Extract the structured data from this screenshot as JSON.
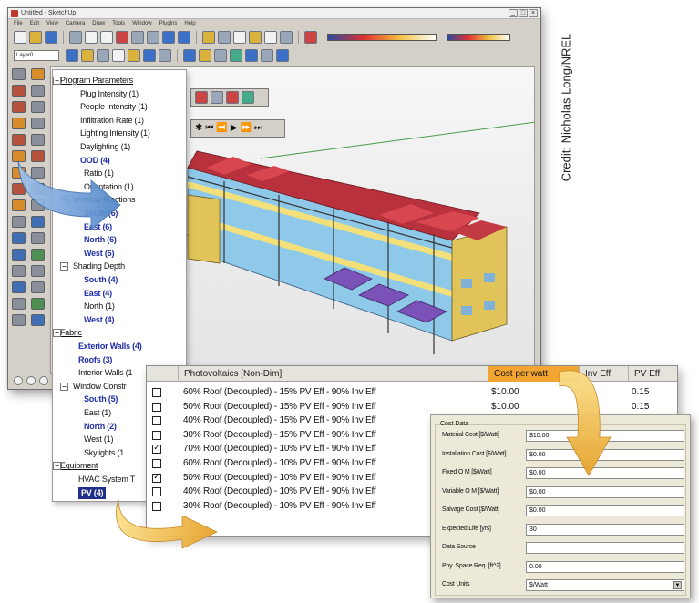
{
  "credit": "Credit: Nicholas Long/NREL",
  "tree": {
    "items": [
      {
        "text": "Program Parameters",
        "style": "u"
      },
      {
        "text": "Plug Intensity (1)",
        "style": ""
      },
      {
        "text": "People Intensity (1)",
        "style": ""
      },
      {
        "text": "Infiltration Rate (1)",
        "style": ""
      },
      {
        "text": "Lighting Intensity (1)",
        "style": ""
      },
      {
        "text": "Daylighting (1)",
        "style": ""
      },
      {
        "text": "OOD (4)",
        "style": "b"
      },
      {
        "text": "Ratio (1)",
        "style": ""
      },
      {
        "text": "Orientation (1)",
        "style": ""
      },
      {
        "text": "Window Fractions",
        "style": ""
      },
      {
        "text": "South (6)",
        "style": "b"
      },
      {
        "text": "East (6)",
        "style": "b"
      },
      {
        "text": "North (6)",
        "style": "b"
      },
      {
        "text": "West (6)",
        "style": "b"
      },
      {
        "text": "Shading Depth",
        "style": ""
      },
      {
        "text": "South (4)",
        "style": "b"
      },
      {
        "text": "East (4)",
        "style": "b"
      },
      {
        "text": "North (1)",
        "style": ""
      },
      {
        "text": "West (4)",
        "style": "b"
      },
      {
        "text": "Fabric",
        "style": "u"
      },
      {
        "text": "Exterior Walls (4)",
        "style": "b"
      },
      {
        "text": "Roofs (3)",
        "style": "b"
      },
      {
        "text": "Interior Walls (1",
        "style": ""
      },
      {
        "text": "Window Constr",
        "style": ""
      },
      {
        "text": "South (5)",
        "style": "b"
      },
      {
        "text": "East (1)",
        "style": ""
      },
      {
        "text": "North (2)",
        "style": "b"
      },
      {
        "text": "West (1)",
        "style": ""
      },
      {
        "text": "Skylights (1",
        "style": ""
      },
      {
        "text": "Equipment",
        "style": "u"
      },
      {
        "text": "HVAC System T",
        "style": ""
      },
      {
        "text": "PV (4)",
        "style": "sel"
      }
    ]
  },
  "pv_table": {
    "columns": [
      "Photovoltaics [Non-Dim]",
      "Cost per watt",
      "Inv Eff",
      "PV Eff"
    ],
    "rows": [
      {
        "label": "60% Roof (Decoupled) - 15% PV Eff - 90% Inv Eff",
        "checked": false,
        "cost": "$10.00",
        "pv": "0.15"
      },
      {
        "label": "50% Roof (Decoupled) - 15% PV Eff - 90% Inv Eff",
        "checked": false,
        "cost": "$10.00",
        "pv": "0.15"
      },
      {
        "label": "40% Roof (Decoupled) - 15% PV Eff - 90% Inv Eff",
        "checked": false,
        "cost": "$10.00",
        "pv": ""
      },
      {
        "label": "30% Roof (Decoupled) - 15% PV Eff - 90% Inv Eff",
        "checked": false,
        "cost": "$10.00",
        "pv": ""
      },
      {
        "label": "70% Roof (Decoupled) - 10% PV Eff - 90% Inv Eff",
        "checked": true,
        "cost": "$10.00",
        "pv": ""
      },
      {
        "label": "60% Roof (Decoupled) - 10% PV Eff - 90% Inv Eff",
        "checked": false,
        "cost": "$10.00",
        "pv": ""
      },
      {
        "label": "50% Roof (Decoupled) - 10% PV Eff - 90% Inv Eff",
        "checked": true,
        "cost": "$10.00",
        "pv": ""
      },
      {
        "label": "40% Roof (Decoupled) - 10% PV Eff - 90% Inv Eff",
        "checked": false,
        "cost": "",
        "pv": ""
      },
      {
        "label": "30% Roof (Decoupled) - 10% PV Eff - 90% Inv Eff",
        "checked": false,
        "cost": "",
        "pv": ""
      }
    ]
  },
  "cost_data": {
    "title": "Cost Data",
    "fields": [
      {
        "label": "Material Cost [$/Watt]",
        "value": "$10.00"
      },
      {
        "label": "Installation Cost [$/Watt]",
        "value": "$0.00"
      },
      {
        "label": "Fixed O M [$/Watt]",
        "value": "$0.00"
      },
      {
        "label": "Variable O M [$/Watt]",
        "value": "$0.00"
      },
      {
        "label": "Salvage Cost [$/Watt]",
        "value": "$0.00"
      },
      {
        "label": "Expected Life [yrs]",
        "value": "30"
      },
      {
        "label": "Data Source",
        "value": ""
      },
      {
        "label": "Phy. Space Req. [ft^2]",
        "value": "0.00"
      },
      {
        "label": "Cost Units",
        "value": "$/Watt"
      }
    ]
  },
  "window": {
    "title": "Untitled - SketchUp",
    "menus": [
      "File",
      "Edit",
      "View",
      "Camera",
      "Draw",
      "Tools",
      "Window",
      "Plugins",
      "Help"
    ],
    "layer": "Layer0"
  },
  "colors": {
    "arrow_blue": "#4f84c9",
    "arrow_gold": "#f0b43a",
    "header_highlight": "#f2a531",
    "roof_red": "#b8313c",
    "pv_purple": "#7b52b8"
  }
}
